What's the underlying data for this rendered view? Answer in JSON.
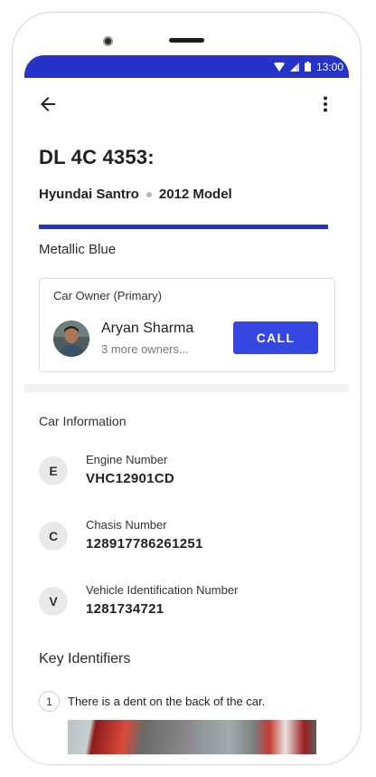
{
  "status_bar": {
    "time": "13:00",
    "color": "#2533c9"
  },
  "app_bar": {
    "back_icon": "arrow-left-icon",
    "more_icon": "more-vert-icon"
  },
  "vehicle": {
    "plate": "DL 4C 4353:",
    "model": "Hyundai Santro",
    "year": "2012 Model",
    "color_name": "Metallic Blue",
    "color_swatch": "#2a35b5"
  },
  "owner_card": {
    "title": "Car Owner (Primary)",
    "name": "Aryan Sharma",
    "more_owners": "3 more owners...",
    "call_label": "CALL"
  },
  "car_information": {
    "title": "Car Information",
    "items": [
      {
        "badge": "E",
        "label": "Engine Number",
        "value": "VHC12901CD"
      },
      {
        "badge": "C",
        "label": "Chasis Number",
        "value": "128917786261251"
      },
      {
        "badge": "V",
        "label": "Vehicle Identification Number",
        "value": "1281734721"
      }
    ]
  },
  "key_identifiers": {
    "title": "Key Identifiers",
    "items": [
      {
        "number": "1",
        "text": "There is a dent on the back of the car."
      }
    ]
  }
}
